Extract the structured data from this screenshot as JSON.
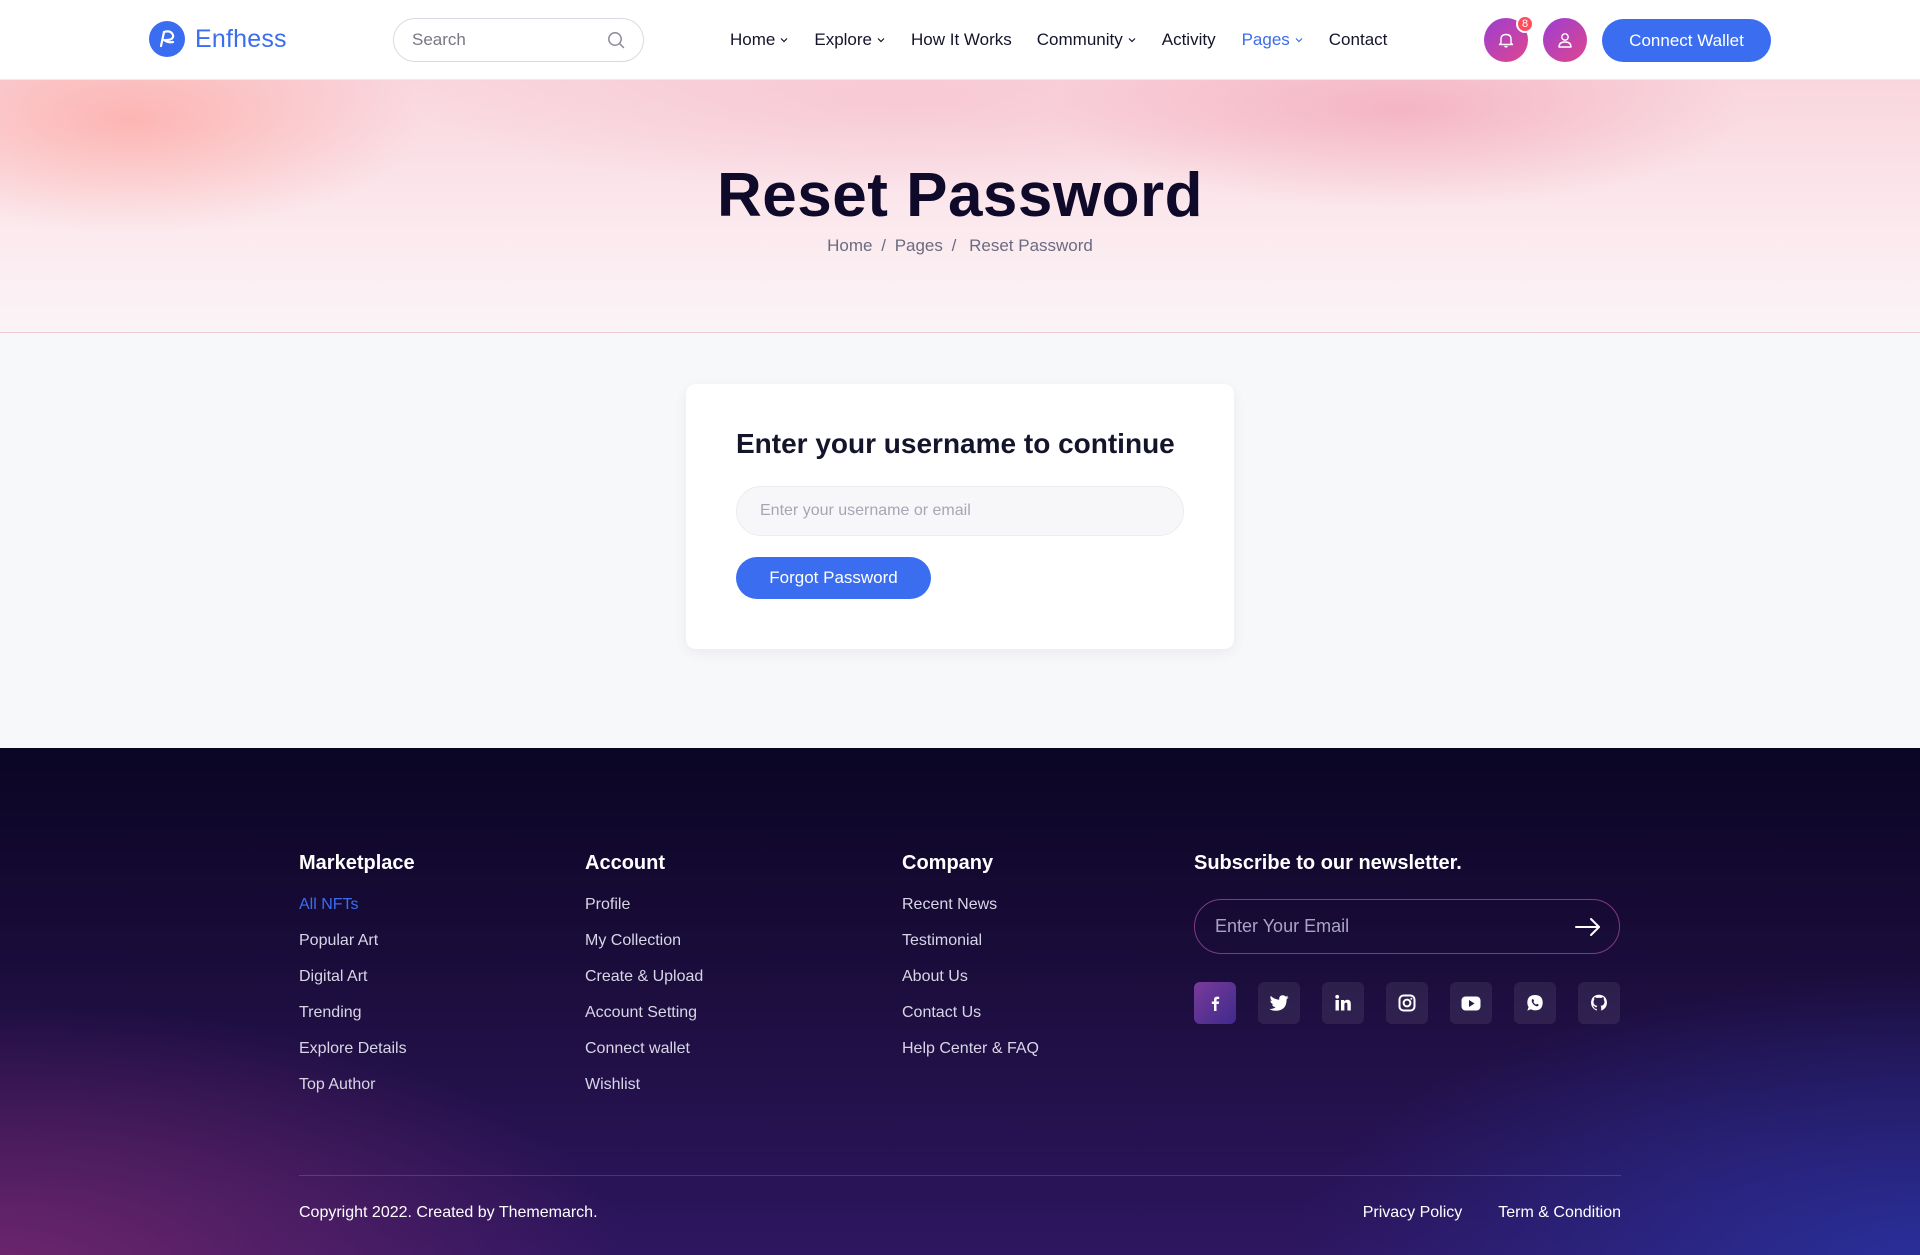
{
  "brand": {
    "name": "Enfhess",
    "color": "#3a6df0"
  },
  "search": {
    "placeholder": "Search"
  },
  "nav": [
    {
      "label": "Home",
      "dropdown": true,
      "active": false
    },
    {
      "label": "Explore",
      "dropdown": true,
      "active": false
    },
    {
      "label": "How It Works",
      "dropdown": false,
      "active": false
    },
    {
      "label": "Community",
      "dropdown": true,
      "active": false
    },
    {
      "label": "Activity",
      "dropdown": false,
      "active": false
    },
    {
      "label": "Pages",
      "dropdown": true,
      "active": true
    },
    {
      "label": "Contact",
      "dropdown": false,
      "active": false
    }
  ],
  "header": {
    "notification_count": "8",
    "connect_label": "Connect Wallet"
  },
  "hero": {
    "title": "Reset Password",
    "breadcrumb": [
      "Home",
      "Pages",
      "Reset Password"
    ]
  },
  "card": {
    "title": "Enter your username to continue",
    "input_placeholder": "Enter your username or email",
    "button_label": "Forgot Password"
  },
  "footer": {
    "columns": [
      {
        "title": "Marketplace",
        "links": [
          "All NFTs",
          "Popular Art",
          "Digital Art",
          "Trending",
          "Explore Details",
          "Top Author"
        ],
        "active_index": 0
      },
      {
        "title": "Account",
        "links": [
          "Profile",
          "My Collection",
          "Create & Upload",
          "Account Setting",
          "Connect wallet",
          "Wishlist"
        ],
        "active_index": -1
      },
      {
        "title": "Company",
        "links": [
          "Recent News",
          "Testimonial",
          "About Us",
          "Contact Us",
          "Help Center & FAQ"
        ],
        "active_index": -1
      }
    ],
    "newsletter": {
      "title": "Subscribe to our newsletter.",
      "placeholder": "Enter Your Email"
    },
    "socials": [
      "facebook-icon",
      "twitter-icon",
      "linkedin-icon",
      "instagram-icon",
      "youtube-icon",
      "whatsapp-icon",
      "github-icon"
    ],
    "copyright": "Copyright 2022. Created by Thememarch.",
    "links": [
      "Privacy Policy",
      "Term & Condition"
    ]
  }
}
